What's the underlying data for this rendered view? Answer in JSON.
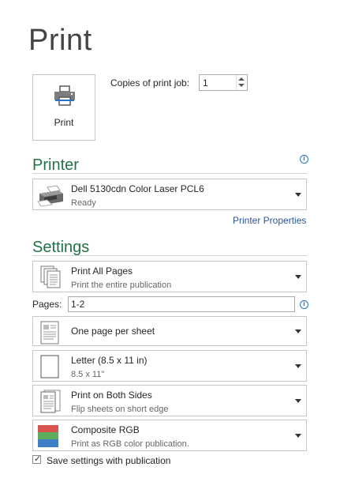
{
  "page": {
    "title": "Print"
  },
  "print_button": {
    "label": "Print",
    "icon": "printer-icon"
  },
  "copies": {
    "label": "Copies of print job:",
    "value": "1"
  },
  "printer": {
    "heading": "Printer",
    "selected": {
      "name": "Dell 5130cdn Color Laser PCL6",
      "status": "Ready"
    },
    "properties_link": "Printer Properties"
  },
  "settings": {
    "heading": "Settings",
    "page_range": {
      "title": "Print All Pages",
      "subtitle": "Print the entire publication"
    },
    "pages": {
      "label": "Pages:",
      "value": "1-2"
    },
    "pages_per_sheet": {
      "title": "One page per sheet"
    },
    "paper_size": {
      "title": "Letter (8.5 x 11 in)",
      "subtitle": "8.5 x 11\""
    },
    "duplex": {
      "title": "Print on Both Sides",
      "subtitle": "Flip sheets on short edge"
    },
    "color": {
      "title": "Composite RGB",
      "subtitle": "Print as RGB color publication."
    },
    "save_settings": {
      "label": "Save settings with publication",
      "checked": true
    }
  },
  "colors": {
    "accent_green": "#217346",
    "link_blue": "#2b579a",
    "info_blue": "#2b72c3"
  }
}
